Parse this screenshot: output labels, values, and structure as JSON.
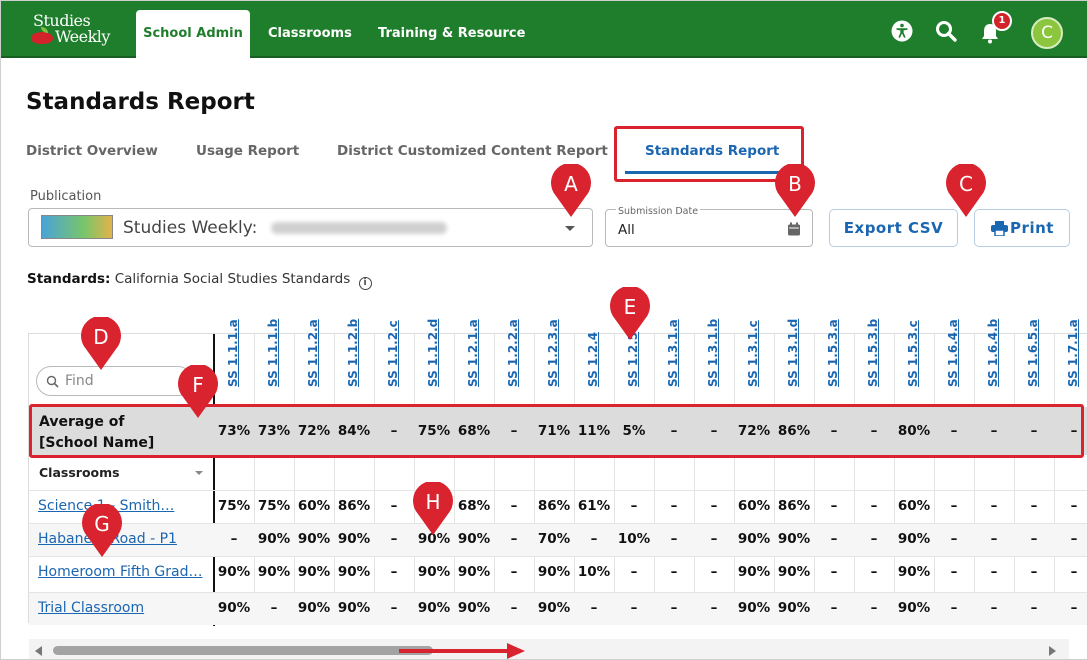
{
  "nav": {
    "logo_line1": "Studies",
    "logo_line2": "Weekly",
    "tabs": [
      "School Admin",
      "Classrooms",
      "Training & Resource"
    ],
    "notification_count": "1",
    "avatar_initial": "C",
    "icons": [
      "accessibility-icon",
      "search-icon",
      "bell-icon"
    ],
    "color": "#1f7e2c"
  },
  "page_title": "Standards Report",
  "subtabs": [
    "District Overview",
    "Usage Report",
    "District Customized Content Report",
    "Standards Report"
  ],
  "publication": {
    "label": "Publication",
    "value": "Studies Weekly:"
  },
  "submission_date": {
    "label": "Submission Date",
    "value": "All"
  },
  "buttons": {
    "export": "Export CSV",
    "print": "Print"
  },
  "standards": {
    "label": "Standards:",
    "value": "California Social Studies Standards"
  },
  "table": {
    "find_placeholder": "Find",
    "columns": [
      "SS 1.1.1.a",
      "SS 1.1.1.b",
      "SS 1.1.2.a",
      "SS 1.1.2.b",
      "SS 1.1.2.c",
      "SS 1.1.2.d",
      "SS 1.2.1.a",
      "SS 1.2.2.a",
      "SS 1.2.3.a",
      "SS 1.2.4",
      "SS 1.2.5",
      "SS 1.3.1.a",
      "SS 1.3.1.b",
      "SS 1.3.1.c",
      "SS 1.3.1.d",
      "SS 1.5.3.a",
      "SS 1.5.3.b",
      "SS 1.5.3.c",
      "SS 1.6.4.a",
      "SS 1.6.4.b",
      "SS 1.6.5.a",
      "SS 1.7.1.a"
    ],
    "average_label_1": "Average of",
    "average_label_2": "[School Name]",
    "average": [
      "73%",
      "73%",
      "72%",
      "84%",
      "–",
      "75%",
      "68%",
      "–",
      "71%",
      "11%",
      "5%",
      "–",
      "–",
      "72%",
      "86%",
      "–",
      "–",
      "80%",
      "–",
      "–",
      "–",
      "–"
    ],
    "classrooms_label": "Classrooms",
    "rows": [
      {
        "name": "Science 1 - Smith…",
        "values": [
          "75%",
          "75%",
          "60%",
          "86%",
          "–",
          "–",
          "68%",
          "–",
          "86%",
          "61%",
          "–",
          "–",
          "–",
          "60%",
          "86%",
          "–",
          "–",
          "60%",
          "–",
          "–",
          "–",
          "–"
        ]
      },
      {
        "name": "Habanero Road - P1",
        "values": [
          "–",
          "90%",
          "90%",
          "90%",
          "–",
          "90%",
          "90%",
          "–",
          "70%",
          "–",
          "10%",
          "–",
          "–",
          "90%",
          "90%",
          "–",
          "–",
          "90%",
          "–",
          "–",
          "–",
          "–"
        ]
      },
      {
        "name": "Homeroom Fifth Grad…",
        "values": [
          "90%",
          "90%",
          "90%",
          "90%",
          "–",
          "90%",
          "90%",
          "–",
          "90%",
          "10%",
          "–",
          "–",
          "–",
          "90%",
          "90%",
          "–",
          "–",
          "90%",
          "–",
          "–",
          "–",
          "–"
        ]
      },
      {
        "name": "Trial Classroom",
        "values": [
          "90%",
          "–",
          "90%",
          "90%",
          "–",
          "90%",
          "90%",
          "–",
          "90%",
          "–",
          "–",
          "–",
          "–",
          "90%",
          "90%",
          "–",
          "–",
          "90%",
          "–",
          "–",
          "–",
          "–"
        ]
      }
    ]
  },
  "annotations": [
    "A",
    "B",
    "C",
    "D",
    "E",
    "F",
    "G",
    "H"
  ],
  "annotation_color": "#d9232f"
}
